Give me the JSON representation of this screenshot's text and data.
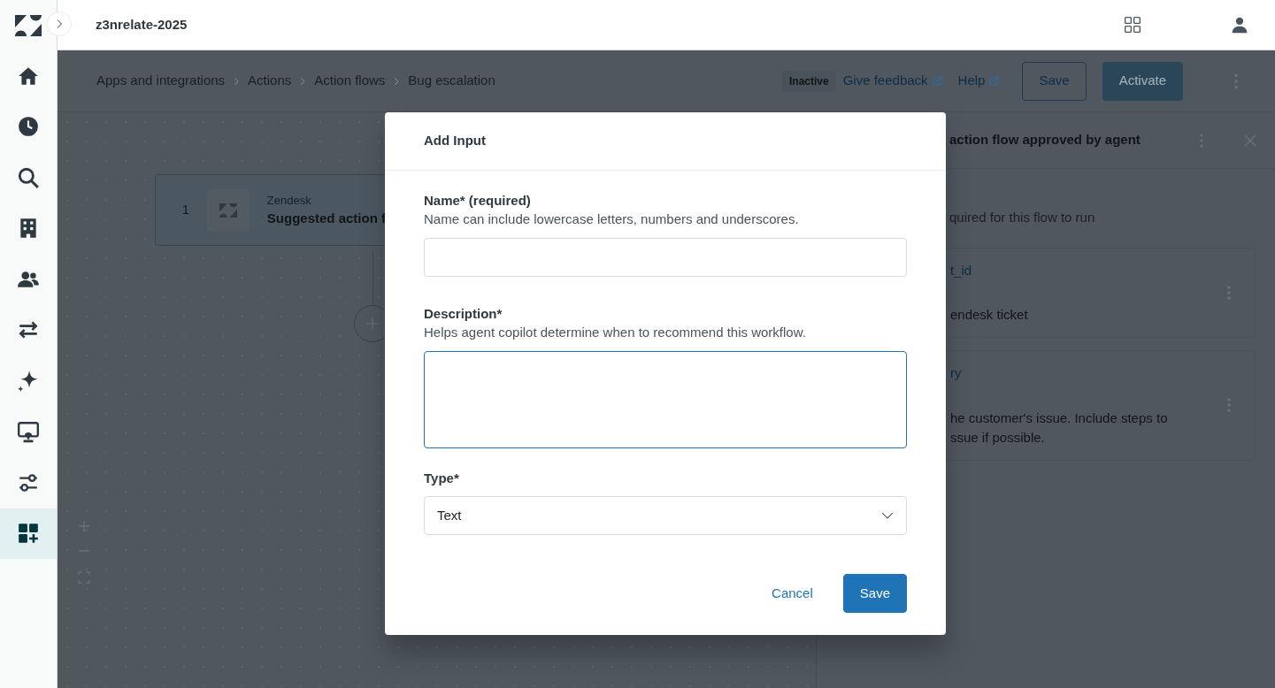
{
  "app": {
    "workspace": "z3nrelate-2025"
  },
  "nav_items": [
    {
      "selected": false
    },
    {
      "selected": false
    },
    {
      "selected": false
    },
    {
      "selected": false
    },
    {
      "selected": false
    },
    {
      "selected": false
    },
    {
      "selected": false
    },
    {
      "selected": false
    },
    {
      "selected": false
    },
    {
      "selected": true
    }
  ],
  "breadcrumbs": [
    "Apps and integrations",
    "Actions",
    "Action flows",
    "Bug escalation"
  ],
  "status_badge": "Inactive",
  "header_links": [
    "Give feedback",
    "Help"
  ],
  "header_buttons": [
    {
      "label": "Save",
      "kind": "outline"
    },
    {
      "label": "Activate",
      "kind": "primary"
    }
  ],
  "canvas": {
    "steps": [
      {
        "number": "1",
        "app": "Zendesk",
        "title": "Suggested action f"
      }
    ]
  },
  "side_panel": {
    "title": "action flow approved by agent",
    "subtitle": "quired for this flow to run",
    "inputs": [
      {
        "name": "t_id",
        "lines": [
          "endesk ticket"
        ]
      },
      {
        "name": "ry",
        "lines": [
          "he customer's issue. Include steps to",
          "ssue if possible."
        ]
      }
    ]
  },
  "modal": {
    "title": "Add Input",
    "fields": [
      {
        "kind": "input",
        "label": "Name* (required)",
        "hint": "Name can include lowercase letters, numbers and underscores.",
        "focused": false
      },
      {
        "kind": "textarea",
        "label": "Description*",
        "hint": "Helps agent copilot determine when to recommend this workflow.",
        "focused": true
      },
      {
        "kind": "select",
        "label": "Type*",
        "value": "Text",
        "focused": false
      }
    ],
    "actions": [
      {
        "label": "Cancel",
        "kind": "link"
      },
      {
        "label": "Save",
        "kind": "primary"
      }
    ]
  }
}
